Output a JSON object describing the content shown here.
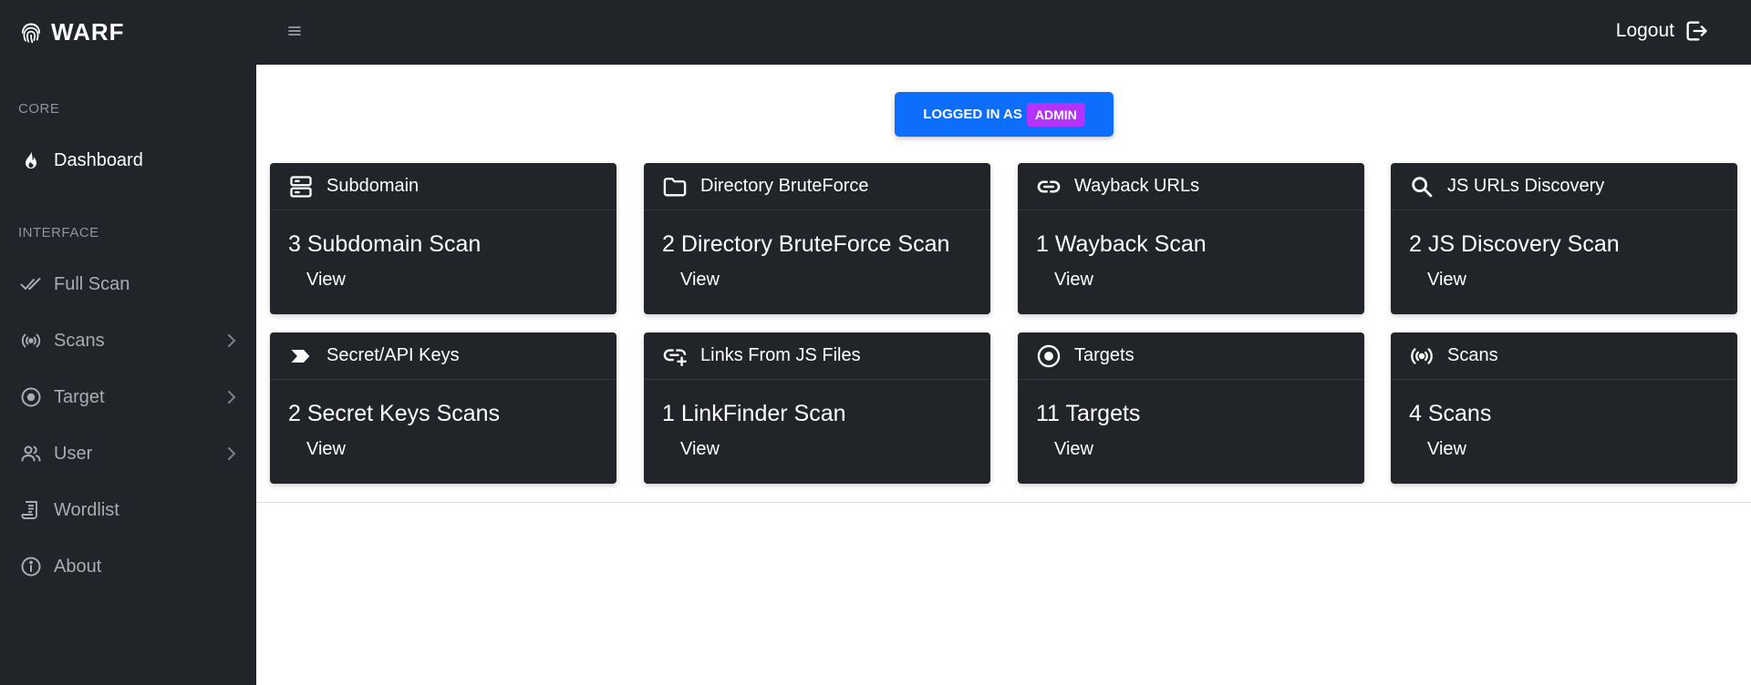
{
  "brand": {
    "name": "WARF"
  },
  "sidebar": {
    "headings": {
      "core": "CORE",
      "interface": "INTERFACE"
    },
    "items": [
      {
        "label": "Dashboard"
      },
      {
        "label": "Full Scan"
      },
      {
        "label": "Scans"
      },
      {
        "label": "Target"
      },
      {
        "label": "User"
      },
      {
        "label": "Wordlist"
      },
      {
        "label": "About"
      }
    ]
  },
  "topbar": {
    "logout_label": "Logout"
  },
  "status": {
    "logged_in_label": "LOGGED IN AS",
    "user_role": "ADMIN"
  },
  "cards": [
    {
      "title": "Subdomain",
      "count": "3 Subdomain Scan",
      "link": "View",
      "icon": "server-icon"
    },
    {
      "title": "Directory BruteForce",
      "count": "2 Directory BruteForce Scan",
      "link": "View",
      "icon": "folder-icon"
    },
    {
      "title": "Wayback URLs",
      "count": "1 Wayback Scan",
      "link": "View",
      "icon": "link-icon"
    },
    {
      "title": "JS URLs Discovery",
      "count": "2 JS Discovery Scan",
      "link": "View",
      "icon": "search-icon"
    },
    {
      "title": "Secret/API Keys",
      "count": "2 Secret Keys Scans",
      "link": "View",
      "icon": "chevron-tag-icon"
    },
    {
      "title": "Links From JS Files",
      "count": "1 LinkFinder Scan",
      "link": "View",
      "icon": "link-add-icon"
    },
    {
      "title": "Targets",
      "count": "11 Targets",
      "link": "View",
      "icon": "target-icon"
    },
    {
      "title": "Scans",
      "count": "4 Scans",
      "link": "View",
      "icon": "broadcast-icon"
    }
  ],
  "colors": {
    "sidebar_bg": "#212529",
    "accent_blue": "#0d6efd",
    "admin_badge": "#b433ff"
  }
}
